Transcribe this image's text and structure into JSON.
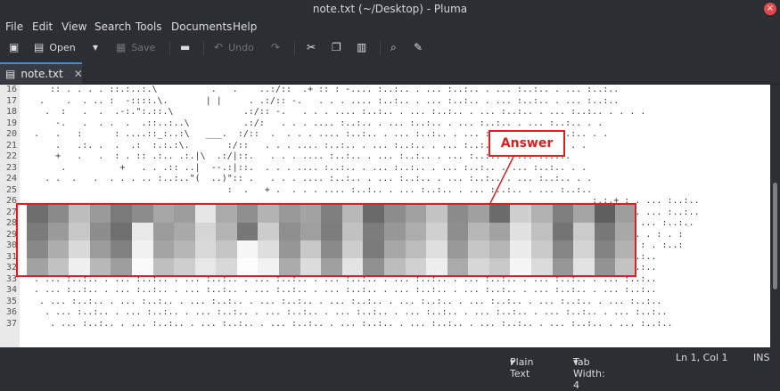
{
  "window": {
    "title": "note.txt (~/Desktop) - Pluma",
    "close_label": "×"
  },
  "menu": {
    "items": [
      "File",
      "Edit",
      "View",
      "Search",
      "Tools",
      "Documents",
      "Help"
    ]
  },
  "toolbar": {
    "open_label": "Open",
    "save_label": "Save",
    "undo_label": "Undo"
  },
  "tab": {
    "label": "note.txt",
    "close": "✕"
  },
  "line_numbers": [
    "16",
    "17",
    "18",
    "19",
    "20",
    "21",
    "22",
    "23",
    "24",
    "25",
    "26",
    "27",
    "28",
    "29",
    "30",
    "31",
    "32",
    "33",
    "34",
    "35",
    "36",
    "37"
  ],
  "lines": [
    "     :: . . . . ::.:..:.\\          .   .    ..:/::  .+ :: : -.... :..:.. . ... :..:.. . ... :..:.. . ... :..:..",
    "   .    .  . .. :  -::::.\\.       | |     . .:/:: -.   . . . .... :..:.. . ... :..:.. . ... :..:.. . ... :..:..",
    "    .  :   .  .  .-:.\":.::.\\             .:/:: -.   . . . .... :..:.. . ... :..:.. . ... :..:.. . ... :..:.. . . . .",
    "      -.   .  . .  .  .::..:..\\          .:/:   . . . .... :..:.. . ... :..:.. . ... :..:.. . ... :..:.. . .",
    "  .   .   :      : ....::_:..:\\   ___.  :/::  .  . . . .... :..:.. . ... :..:.. . ... :..:.. . ... :..:.. . .",
    "      .   .:. .  .  .:  :.:.:\\.       :/::   . . . .... :..:.. . ... :..:.. . ... :..:.. . ... :..:.. . .",
    "      +   .   .  : . :: .:.. .:.|\\  .:/|::.   . . . .... :..:.. . ... :..:.. . ... :..:.. . ... :..:..",
    "       .          +   . . .:: ..|  --.:|::.  . . . .... :..:.. . ... :..:.. . ... :..:.. . ... :..:.. . .",
    "    . .  .   .  . . . .. :..:..\"(  ..)\":: .   . . . .... :..:.. . ... :..:.. . ... :..:.. . ... :..:.. . .",
    "                                      :  .   + .  . . . .... :..:.. . ... :..:.. . ... :..:.. . ... :..:..",
    "                                                                                                          :.:.+ : . ... :..:..",
    "                                                                                                          :.: + . . ... :..:..",
    "                                                                                                          :.:. . . ... :..:..",
    "                                                                                                          :.::+.+.. . : . :",
    "                                                                                                          :+..+. . : . :..:",
    "  . ... :..:.. . ... :..:.. . ... :..:.. . ... :..:.. . ... :..:.. . ... :..:.. . ... :..:.. . ... :..:.. . ... :..:..",
    "  . ... :..:.. . ... :..:.. . ... :..:.. . ... :..:.. . ... :..:.. . ... :..:.. . ... :..:.. . ... :..:.. . ... :..:..",
    "  . ... :..:.. . ... :..:.. . ... :..:.. . ... :..:.. . ... :..:.. . ... :..:.. . ... :..:.. . ... :..:.. . ... :..:..",
    "  . ... :..:.. . ... :..:.. . ... :..:.. . ... :..:.. . ... :..:.. . ... :..:.. . ... :..:.. . ... :..:.. . ... :..:..",
    "   . ... :..:.. . ... :..:.. . ... :..:.. . ... :..:.. . ... :..:.. . ... :..:.. . ... :..:.. . ... :..:.. . ... :..:..",
    "    . ... :..:.. . ... :..:.. . ... :..:.. . ... :..:.. . ... :..:.. . ... :..:.. . ... :..:.. . ... :..:.. . ... :..:..",
    "     . ... :..:.. . ... :..:.. . ... :..:.. . ... :..:.. . ... :..:.. . ... :..:.. . ... :..:.. . ... :..:.. . ... :..:.."
  ],
  "annotation": {
    "label": "Answer",
    "color": "#e01e1e"
  },
  "pixelation": {
    "shades": [
      "#6e6e6e",
      "#8a8a8a",
      "#bdbdbd",
      "#9a9a9a",
      "#7a7a7a",
      "#8c8c8c",
      "#a6a6a6",
      "#9d9d9d",
      "#e6e6e6",
      "#aaaaaa",
      "#8f8f8f",
      "#b3b3b3",
      "#999999",
      "#a3a3a3",
      "#7f7f7f",
      "#b8b8b8",
      "#6a6a6a",
      "#8d8d8d",
      "#a1a1a1",
      "#c4c4c4",
      "#8b8b8b",
      "#a0a0a0",
      "#6b6b6b",
      "#cfcfcf",
      "#b1b1b1",
      "#7e7e7e",
      "#a5a5a5",
      "#5f5f5f",
      "#9e9e9e",
      "#7b7b7b",
      "#9a9a9a",
      "#c7c7c7",
      "#8d8d8d",
      "#6f6f6f",
      "#e9e9e9",
      "#9b9b9b",
      "#a9a9a9",
      "#d6d6d6",
      "#b4b4b4",
      "#777777",
      "#cccccc",
      "#8f8f8f",
      "#9f9f9f",
      "#7d7d7d",
      "#c1c1c1",
      "#7c7c7c",
      "#989898",
      "#adadad",
      "#d0d0d0",
      "#8e8e8e",
      "#b7b7b7",
      "#a2a2a2",
      "#e1e1e1",
      "#c0c0c0",
      "#747474",
      "#cbcbcb",
      "#787878",
      "#a8a8a8",
      "#888888",
      "#aeaeae",
      "#dadada",
      "#9c9c9c",
      "#818181",
      "#f1f1f1",
      "#a4a4a4",
      "#b6b6b6",
      "#d9d9d9",
      "#c5c5c5",
      "#f7f7f7",
      "#dedede",
      "#969696",
      "#c8c8c8",
      "#8a8a8a",
      "#cdcdcd",
      "#7a7a7a",
      "#a7a7a7",
      "#bcbcbc",
      "#dfdfdf",
      "#999999",
      "#c6c6c6",
      "#b5b5b5",
      "#ececec",
      "#cacaca",
      "#858585",
      "#d4d4d4",
      "#838383",
      "#b2b2b2",
      "#a3a3a3",
      "#c2c2c2",
      "#f0f0f0",
      "#b9b9b9",
      "#9e9e9e",
      "#fafafa",
      "#bfbfbf",
      "#cecece",
      "#e8e8e8",
      "#d8d8d8",
      "#fdfdfd",
      "#f2f2f2",
      "#ababab",
      "#dcdcdc",
      "#a0a0a0",
      "#e4e4e4",
      "#909090",
      "#bdbdbd",
      "#d1d1d1",
      "#eeeeee",
      "#aaaaaa",
      "#d7d7d7",
      "#c9c9c9",
      "#f5f5f5",
      "#dbdbdb",
      "#979797",
      "#e3e3e3",
      "#939393",
      "#c3c3c3"
    ]
  },
  "status": {
    "syntax": "Plain Text",
    "tab_width": "Tab Width: 4",
    "position": "Ln 1, Col 1",
    "mode": "INS"
  }
}
